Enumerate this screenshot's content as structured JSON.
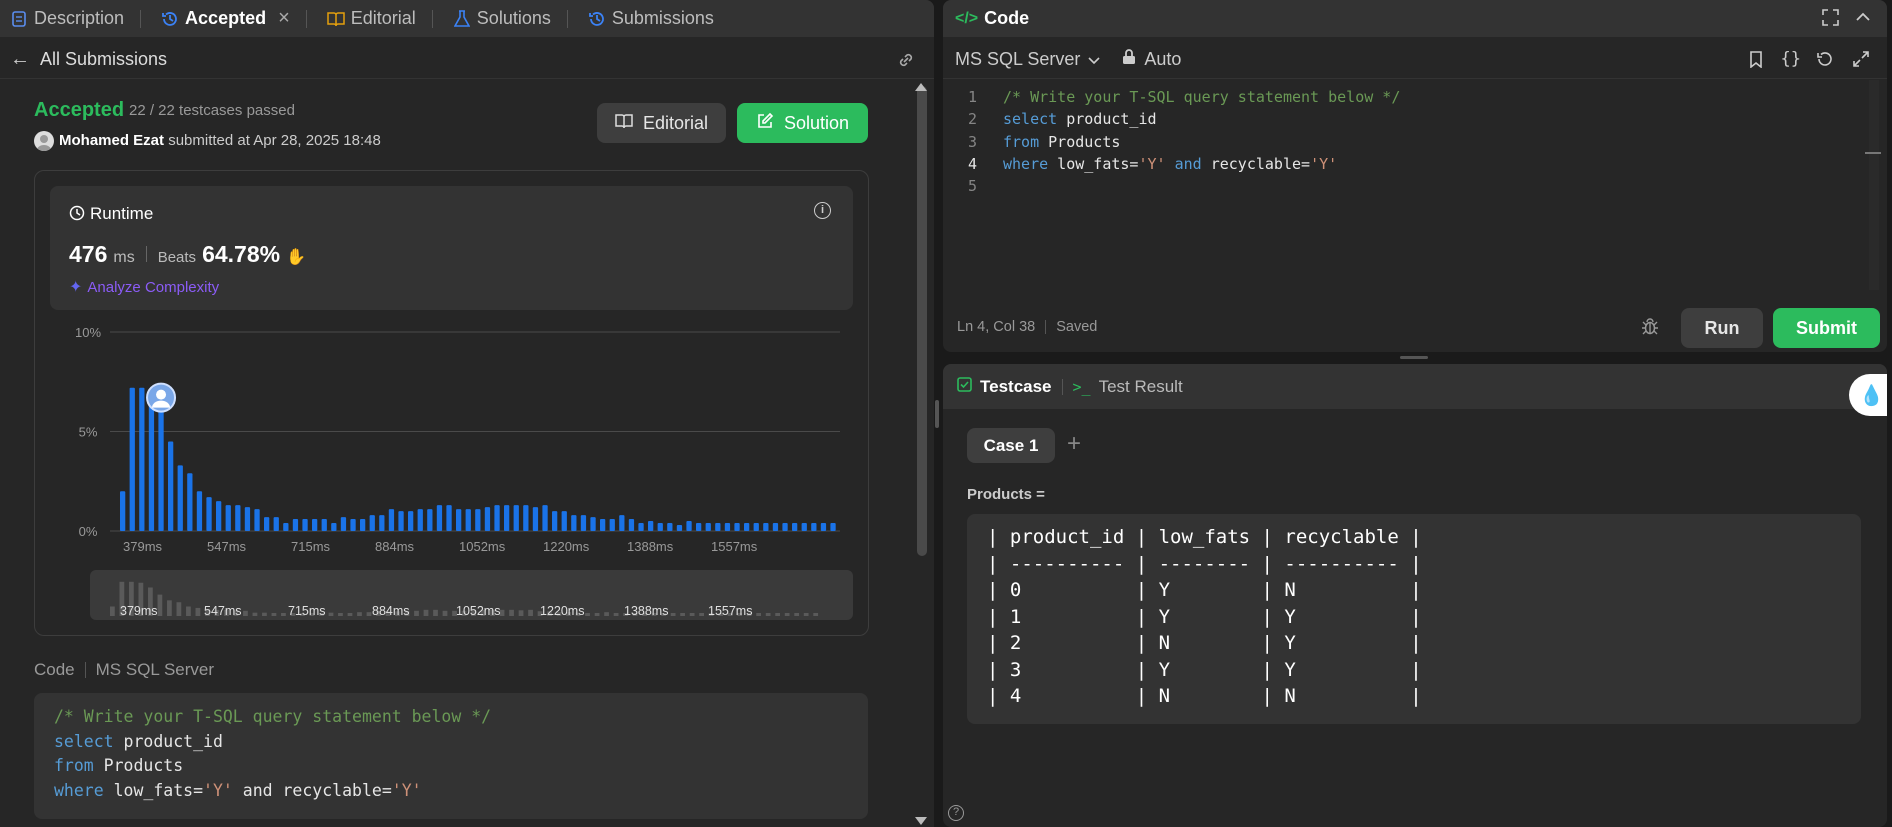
{
  "tabs": [
    {
      "label": "Description",
      "icon": "description-icon"
    },
    {
      "label": "Accepted",
      "icon": "history-icon",
      "active": true
    },
    {
      "label": "Editorial",
      "icon": "book-icon"
    },
    {
      "label": "Solutions",
      "icon": "flask-icon"
    },
    {
      "label": "Submissions",
      "icon": "history-icon"
    }
  ],
  "back": {
    "label": "All Submissions"
  },
  "result": {
    "status": "Accepted",
    "testcases": "22 / 22 testcases passed",
    "user": "Mohamed Ezat",
    "submitted": "submitted at Apr 28, 2025 18:48",
    "editorial_btn": "Editorial",
    "solution_btn": "Solution"
  },
  "runtime": {
    "title": "Runtime",
    "value": "476",
    "unit": "ms",
    "beats_label": "Beats",
    "beats_value": "64.78%",
    "analyze": "Analyze Complexity"
  },
  "chart_data": {
    "type": "bar",
    "yticks": [
      "10%",
      "5%",
      "0%"
    ],
    "ylim": [
      0,
      10
    ],
    "xticks": [
      "379ms",
      "547ms",
      "715ms",
      "884ms",
      "1052ms",
      "1220ms",
      "1388ms",
      "1557ms"
    ],
    "values": [
      2.0,
      7.2,
      7.2,
      7.0,
      6.0,
      4.5,
      3.3,
      2.9,
      2.0,
      1.7,
      1.5,
      1.3,
      1.3,
      1.2,
      1.1,
      0.7,
      0.7,
      0.4,
      0.6,
      0.6,
      0.6,
      0.6,
      0.4,
      0.7,
      0.6,
      0.6,
      0.8,
      0.8,
      1.1,
      1.0,
      1.0,
      1.1,
      1.1,
      1.3,
      1.3,
      1.1,
      1.1,
      1.1,
      1.2,
      1.3,
      1.3,
      1.3,
      1.3,
      1.2,
      1.3,
      1.0,
      1.0,
      0.8,
      0.8,
      0.7,
      0.6,
      0.6,
      0.8,
      0.6,
      0.4,
      0.5,
      0.4,
      0.4,
      0.3,
      0.5,
      0.4,
      0.4,
      0.4,
      0.4,
      0.4,
      0.4,
      0.4,
      0.4,
      0.4,
      0.4,
      0.4,
      0.4,
      0.4,
      0.4,
      0.4
    ],
    "highlight_index": 4,
    "bar_color": "#1a73e8"
  },
  "code_section": {
    "label": "Code",
    "lang": "MS SQL Server"
  },
  "code": [
    [
      {
        "t": "/* Write your T-SQL query statement below */",
        "c": "cm"
      }
    ],
    [
      {
        "t": "select",
        "c": "kw"
      },
      {
        "t": " product_id",
        "c": "tx"
      }
    ],
    [
      {
        "t": "from",
        "c": "kw"
      },
      {
        "t": " Products",
        "c": "tx"
      }
    ],
    [
      {
        "t": "where",
        "c": "kw"
      },
      {
        "t": " low_fats=",
        "c": "tx"
      },
      {
        "t": "'Y'",
        "c": "str"
      },
      {
        "t": " and recyclable=",
        "c": "tx"
      },
      {
        "t": "'Y'",
        "c": "str"
      }
    ]
  ],
  "editor": {
    "title": "Code",
    "language": "MS SQL Server",
    "mode": "Auto",
    "line_numbers": [
      "1",
      "2",
      "3",
      "4",
      "5"
    ],
    "lines": [
      [
        {
          "t": "/* Write your T-SQL query statement below */",
          "c": "cm"
        }
      ],
      [
        {
          "t": "select",
          "c": "kw"
        },
        {
          "t": " product_id",
          "c": "tx"
        }
      ],
      [
        {
          "t": "from",
          "c": "kw"
        },
        {
          "t": " Products",
          "c": "tx"
        }
      ],
      [
        {
          "t": "where",
          "c": "kw"
        },
        {
          "t": " low_fats=",
          "c": "tx"
        },
        {
          "t": "'Y'",
          "c": "str"
        },
        {
          "t": " and",
          "c": "kw"
        },
        {
          "t": " recyclable=",
          "c": "tx"
        },
        {
          "t": "'Y'",
          "c": "str"
        }
      ],
      []
    ],
    "status": "Ln 4, Col 38",
    "saved": "Saved",
    "run": "Run",
    "submit": "Submit"
  },
  "testcase": {
    "tab_testcase": "Testcase",
    "tab_result": "Test Result",
    "case_label": "Case 1",
    "input_label": "Products =",
    "table_lines": [
      "| product_id | low_fats | recyclable |",
      "| ---------- | -------- | ---------- |",
      "| 0          | Y        | N          |",
      "| 1          | Y        | Y          |",
      "| 2          | N        | Y          |",
      "| 3          | Y        | Y          |",
      "| 4          | N        | N          |"
    ]
  },
  "colors": {
    "accent_green": "#2cbb5d",
    "brand_blue": "#1a73e8",
    "purple": "#8b5cf6"
  }
}
